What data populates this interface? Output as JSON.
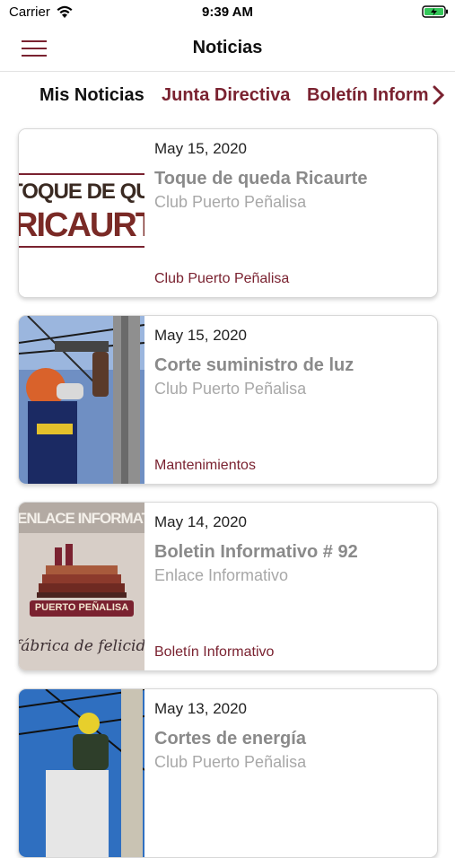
{
  "status_bar": {
    "carrier": "Carrier",
    "time": "9:39 AM"
  },
  "header": {
    "title": "Noticias"
  },
  "tabs": [
    "Mis Noticias",
    "Junta Directiva",
    "Boletín Informativo"
  ],
  "colors": {
    "accent": "#7a2230"
  },
  "news": [
    {
      "date": "May 15, 2020",
      "title": "Toque de queda Ricaurte",
      "source": "Club Puerto Peñalisa",
      "category": "Club Puerto Peñalisa",
      "thumb_text": [
        "TOQUE DE QUEDA",
        "RICAURTE"
      ]
    },
    {
      "date": "May 15, 2020",
      "title": "Corte suministro de luz",
      "source": "Club Puerto Peñalisa",
      "category": "Mantenimientos"
    },
    {
      "date": "May 14, 2020",
      "title": "Boletin Informativo # 92",
      "source": "Enlace Informativo",
      "category": "Boletín Informativo",
      "thumb_text": [
        "ENLACE INFORMATIVO",
        "PUERTO PEÑALISA",
        "fábrica de felicidad"
      ]
    },
    {
      "date": "May 13, 2020",
      "title": "Cortes de energía",
      "source": "Club Puerto Peñalisa",
      "category": ""
    }
  ]
}
